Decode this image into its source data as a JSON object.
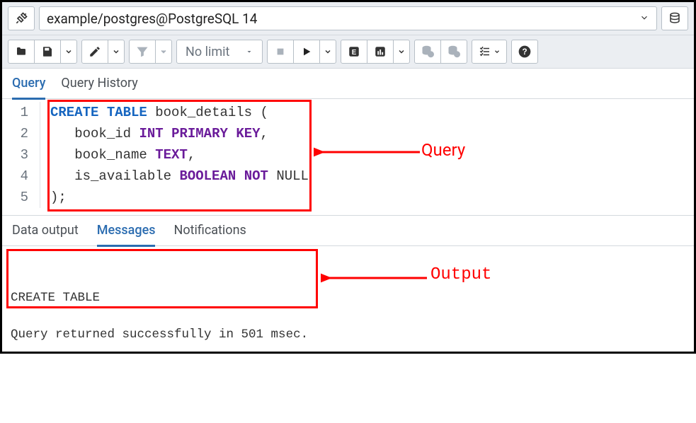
{
  "connection": {
    "label": "example/postgres@PostgreSQL 14"
  },
  "toolbar": {
    "nolimit_label": "No limit"
  },
  "tabs": {
    "query": "Query",
    "history": "Query History"
  },
  "output_tabs": {
    "data": "Data output",
    "messages": "Messages",
    "notifications": "Notifications"
  },
  "code_lines": [
    {
      "n": 1,
      "tokens": [
        [
          "kw",
          "CREATE"
        ],
        [
          "sp",
          " "
        ],
        [
          "kw",
          "TABLE"
        ],
        [
          "sp",
          " "
        ],
        [
          "id",
          "book_details"
        ],
        [
          "sp",
          " "
        ],
        [
          "punc",
          "("
        ]
      ]
    },
    {
      "n": 2,
      "tokens": [
        [
          "sp",
          "   "
        ],
        [
          "id",
          "book_id"
        ],
        [
          "sp",
          " "
        ],
        [
          "ty",
          "INT"
        ],
        [
          "sp",
          " "
        ],
        [
          "mod",
          "PRIMARY"
        ],
        [
          "sp",
          " "
        ],
        [
          "mod",
          "KEY"
        ],
        [
          "punc",
          ","
        ]
      ]
    },
    {
      "n": 3,
      "tokens": [
        [
          "sp",
          "   "
        ],
        [
          "id",
          "book_name"
        ],
        [
          "sp",
          " "
        ],
        [
          "ty",
          "TEXT"
        ],
        [
          "punc",
          ","
        ]
      ]
    },
    {
      "n": 4,
      "tokens": [
        [
          "sp",
          "   "
        ],
        [
          "id",
          "is_available"
        ],
        [
          "sp",
          " "
        ],
        [
          "ty",
          "BOOLEAN"
        ],
        [
          "sp",
          " "
        ],
        [
          "mod",
          "NOT"
        ],
        [
          "sp",
          " "
        ],
        [
          "id",
          "NULL"
        ]
      ]
    },
    {
      "n": 5,
      "tokens": [
        [
          "punc",
          ");"
        ]
      ]
    }
  ],
  "messages": {
    "line1": "CREATE TABLE",
    "line2": "",
    "line3": "Query returned successfully in 501 msec."
  },
  "annotations": {
    "query_label": "Query",
    "output_label": "Output"
  }
}
